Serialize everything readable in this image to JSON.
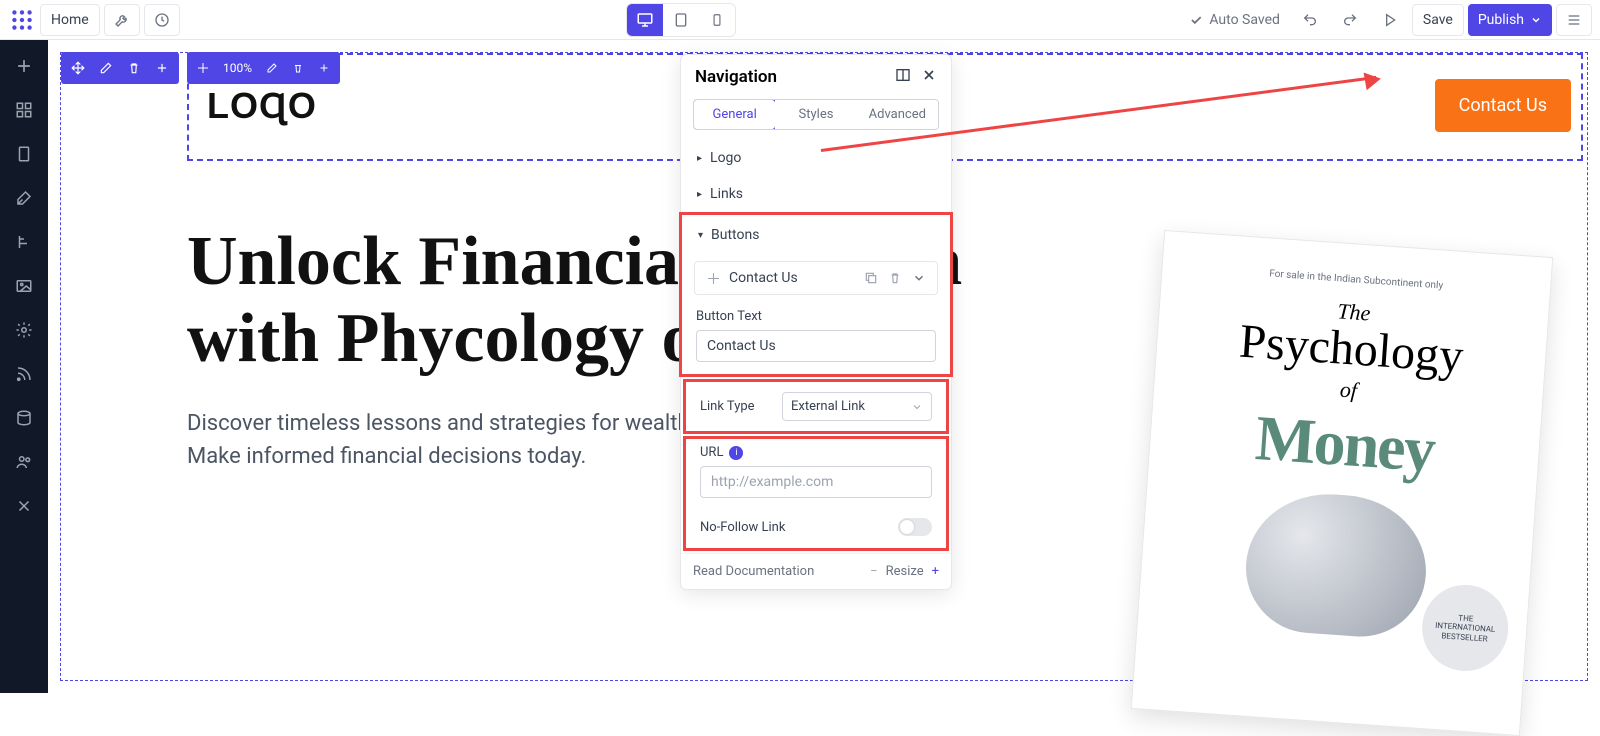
{
  "topbar": {
    "home": "Home",
    "autosaved": "Auto Saved",
    "save": "Save",
    "publish": "Publish"
  },
  "panel": {
    "title": "Navigation",
    "tabs": {
      "general": "General",
      "styles": "Styles",
      "advanced": "Advanced"
    },
    "sections": {
      "logo": "Logo",
      "links": "Links",
      "buttons": "Buttons"
    },
    "item_label": "Contact Us",
    "button_text_label": "Button Text",
    "button_text_value": "Contact Us",
    "link_type_label": "Link Type",
    "link_type_value": "External Link",
    "url_label": "URL",
    "url_placeholder": "http://example.com",
    "nofollow_label": "No-Follow Link",
    "read_docs": "Read Documentation",
    "resize": "Resize"
  },
  "nav": {
    "zoom": "100%",
    "contact_label": "Contact Us"
  },
  "hero": {
    "heading": "Unlock Financial Wisdom with Phycology of Money",
    "sub": "Discover timeless lessons and strategies for wealth-building. Make informed financial decisions today."
  },
  "book": {
    "tag": "For sale in the Indian Subcontinent only",
    "the": "The",
    "psy": "Psychology",
    "of": "of",
    "money": "Money",
    "badge": "THE INTERNATIONAL BESTSELLER"
  },
  "logo_text": "LOɊO"
}
